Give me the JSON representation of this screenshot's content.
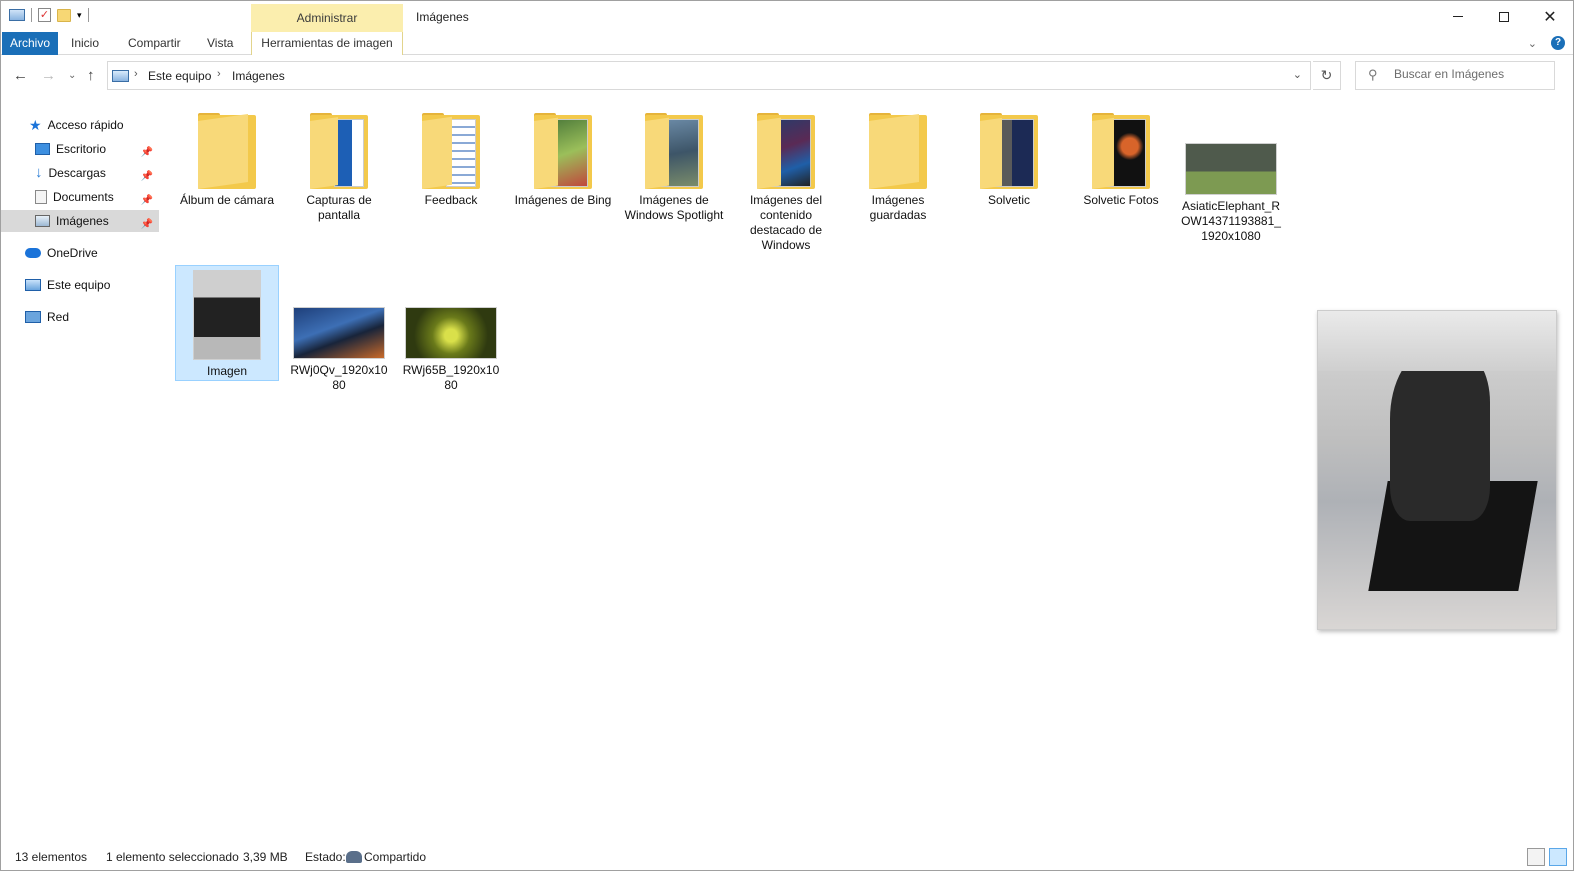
{
  "titlebar": {
    "title": "Imágenes",
    "context_tab": "Administrar",
    "minimize": "—",
    "maximize": "☐",
    "close": "✕"
  },
  "ribbon": {
    "tabs": [
      "Archivo",
      "Inicio",
      "Compartir",
      "Vista",
      "Herramientas de imagen"
    ],
    "help": "?"
  },
  "address": {
    "crumbs": [
      "Este equipo",
      "Imágenes"
    ],
    "search_placeholder": "Buscar en Imágenes"
  },
  "sidebar": {
    "quick_access": "Acceso rápido",
    "items": [
      "Escritorio",
      "Descargas",
      "Documents",
      "Imágenes"
    ],
    "onedrive": "OneDrive",
    "this_pc": "Este equipo",
    "network": "Red"
  },
  "items": [
    {
      "name": "Álbum de cámara",
      "type": "folder"
    },
    {
      "name": "Capturas de pantalla",
      "type": "folder"
    },
    {
      "name": "Feedback",
      "type": "folder"
    },
    {
      "name": "Imágenes de Bing",
      "type": "folder"
    },
    {
      "name": "Imágenes de Windows Spotlight",
      "type": "folder"
    },
    {
      "name": "Imágenes del contenido destacado de Windows",
      "type": "folder"
    },
    {
      "name": "Imágenes guardadas",
      "type": "folder"
    },
    {
      "name": "Solvetic",
      "type": "folder"
    },
    {
      "name": "Solvetic Fotos",
      "type": "folder"
    },
    {
      "name": "AsiaticElephant_ROW14371193881_1920x1080",
      "type": "image"
    },
    {
      "name": "Imagen",
      "type": "image",
      "selected": true
    },
    {
      "name": "RWj0Qv_1920x1080",
      "type": "image"
    },
    {
      "name": "RWj65B_1920x1080",
      "type": "image"
    }
  ],
  "status": {
    "count": "13 elementos",
    "selected": "1 elemento seleccionado",
    "size": "3,39 MB",
    "state_label": "Estado:",
    "state_value": "Compartido"
  },
  "colors": {
    "accent": "#1a6fb8",
    "context_tab": "#fbeeae",
    "selection": "#cce8ff",
    "folder": "#f3c94b"
  }
}
